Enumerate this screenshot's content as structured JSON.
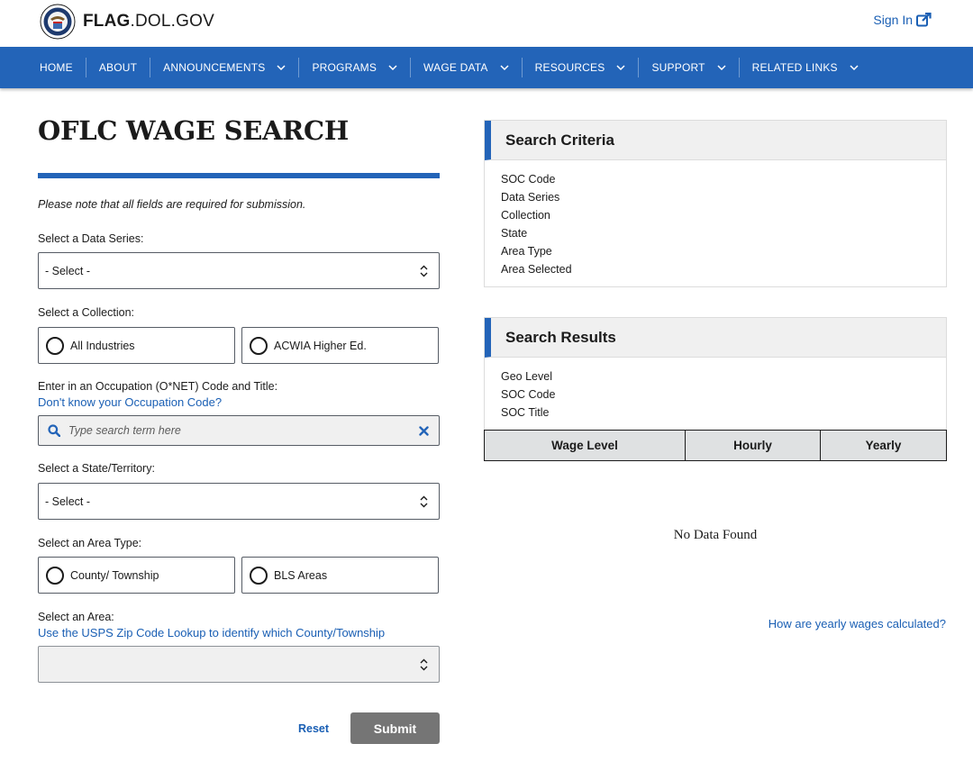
{
  "header": {
    "site_name_bold": "FLAG",
    "site_name_rest": ".DOL.GOV",
    "sign_in": "Sign In",
    "logo_icon": "dol-seal-icon",
    "external_icon": "external-link-icon"
  },
  "nav": {
    "items": [
      {
        "label": "HOME",
        "dropdown": false
      },
      {
        "label": "ABOUT",
        "dropdown": false
      },
      {
        "label": "ANNOUNCEMENTS",
        "dropdown": true
      },
      {
        "label": "PROGRAMS",
        "dropdown": true
      },
      {
        "label": "WAGE DATA",
        "dropdown": true
      },
      {
        "label": "RESOURCES",
        "dropdown": true
      },
      {
        "label": "SUPPORT",
        "dropdown": true
      },
      {
        "label": "RELATED LINKS",
        "dropdown": true
      }
    ]
  },
  "form": {
    "title": "OFLC WAGE SEARCH",
    "note": "Please note that all fields are required for submission.",
    "data_series_label": "Select a Data Series:",
    "data_series_value": "- Select -",
    "collection_label": "Select a Collection:",
    "collection_options": [
      "All Industries",
      "ACWIA Higher Ed."
    ],
    "occupation_label": "Enter in an Occupation (O*NET) Code and Title:",
    "occupation_help_link": "Don't know your Occupation Code?",
    "search_placeholder": "Type search term here",
    "state_label": "Select a State/Territory:",
    "state_value": "- Select -",
    "area_type_label": "Select an Area Type:",
    "area_type_options": [
      "County/ Township",
      "BLS Areas"
    ],
    "area_label": "Select an Area:",
    "area_help_link": "Use the USPS Zip Code Lookup to identify which County/Township",
    "area_value": "",
    "reset_label": "Reset",
    "submit_label": "Submit"
  },
  "criteria": {
    "title": "Search Criteria",
    "fields": [
      "SOC Code",
      "Data Series",
      "Collection",
      "State",
      "Area Type",
      "Area Selected"
    ]
  },
  "results": {
    "title": "Search Results",
    "fields": [
      "Geo Level",
      "SOC Code",
      "SOC Title"
    ],
    "columns": [
      "Wage Level",
      "Hourly",
      "Yearly"
    ],
    "empty_message": "No Data Found",
    "yearly_link": "How are yearly wages calculated?"
  },
  "colors": {
    "brand_blue": "#2364b8",
    "link_blue": "#1a5fb4",
    "submit_gray": "#757575"
  }
}
